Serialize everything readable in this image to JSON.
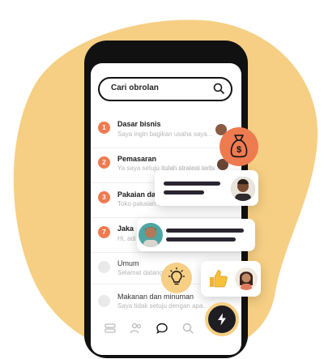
{
  "search": {
    "placeholder": "Cari obrolan"
  },
  "chats": [
    {
      "badge": "1",
      "title": "Dasar bisnis",
      "preview": "Saya ingin bagikan usaha saya..."
    },
    {
      "badge": "2",
      "title": "Pemasaran",
      "preview": "Ya saya setuju itulah strategi terbaik"
    },
    {
      "badge": "3",
      "title": "Pakaian dan",
      "preview": "Toko pakaian ini"
    },
    {
      "badge": "7",
      "title": "Jaka",
      "preview": "Hi, adi"
    },
    {
      "badge": "",
      "title": "Umum",
      "preview": "Selamat datang Pak..."
    },
    {
      "badge": "",
      "title": "Makanan dan minuman",
      "preview": "Saya tidak setuju dengan apa..."
    }
  ],
  "icons": {
    "money_bag": "money-bag-icon",
    "lightbulb": "lightbulb-icon",
    "thumbs_up": "thumbs-up-icon",
    "bolt": "lightning-bolt-icon"
  },
  "colors": {
    "accent": "#ee7b50",
    "blob": "#f6cf84",
    "dark": "#111111"
  }
}
